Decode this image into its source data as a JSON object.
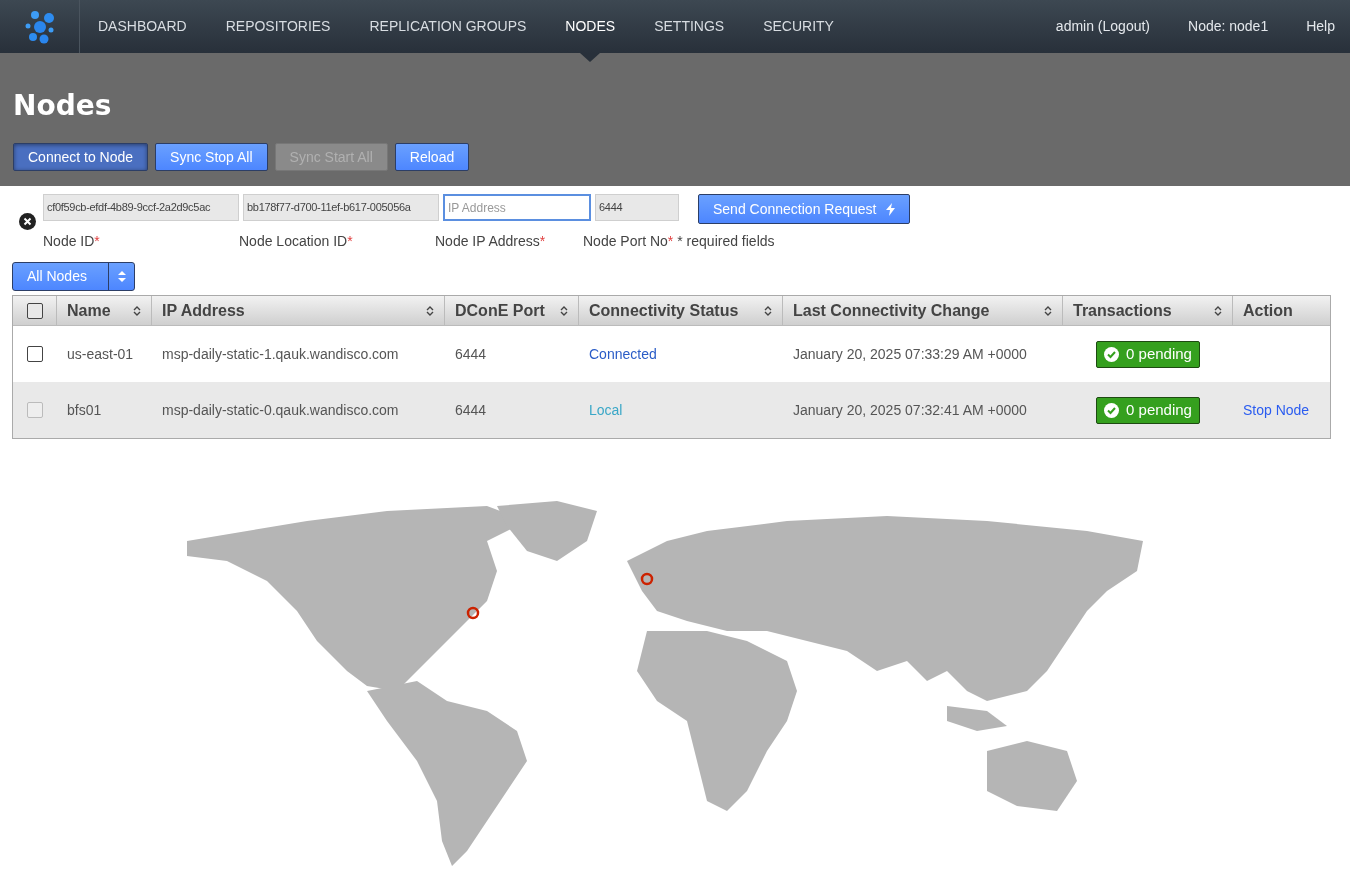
{
  "nav": {
    "items": [
      {
        "label": "DASHBOARD",
        "selected": false
      },
      {
        "label": "REPOSITORIES",
        "selected": false
      },
      {
        "label": "REPLICATION GROUPS",
        "selected": false
      },
      {
        "label": "NODES",
        "selected": true
      },
      {
        "label": "SETTINGS",
        "selected": false
      },
      {
        "label": "SECURITY",
        "selected": false
      }
    ],
    "right_links": [
      "admin (Logout)",
      "Node: node1",
      "Help"
    ]
  },
  "page_title": "Nodes",
  "toolbar": [
    {
      "label": "Connect to Node",
      "pressed": true,
      "disabled": false
    },
    {
      "label": "Sync Stop All",
      "pressed": false,
      "disabled": false
    },
    {
      "label": "Sync Start All",
      "pressed": false,
      "disabled": true
    },
    {
      "label": "Reload",
      "pressed": false,
      "disabled": false
    }
  ],
  "connect_form": {
    "fields": [
      {
        "value": "cf0f59cb-efdf-4b89-9ccf-2a2d9c5ac",
        "label": "Node ID",
        "required_mark": "*",
        "editable": false
      },
      {
        "value": "bb178f77-d700-11ef-b617-005056a",
        "label": "Node Location ID",
        "required_mark": "*",
        "editable": false
      },
      {
        "placeholder": "IP Address",
        "label": "Node IP Address",
        "required_mark": "*",
        "editable": true
      },
      {
        "value": "6444",
        "label": "Node Port No",
        "required_mark": "*",
        "editable": false
      }
    ],
    "required_note": "* required fields",
    "send_button": "Send Connection Request"
  },
  "filter": {
    "value": "All Nodes"
  },
  "table": {
    "select_all": {
      "checked": false
    },
    "columns": [
      {
        "label": "Name",
        "sortable": true
      },
      {
        "label": "IP Address",
        "sortable": true
      },
      {
        "label": "DConE Port",
        "sortable": true
      },
      {
        "label": "Connectivity Status",
        "sortable": true
      },
      {
        "label": "Last Connectivity Change",
        "sortable": true
      },
      {
        "label": "Transactions",
        "sortable": true
      },
      {
        "label": "Action",
        "sortable": false
      }
    ],
    "rows": [
      {
        "checked": false,
        "disabled": false,
        "name": "us-east-01",
        "ip": "msp-daily-static-1.qauk.wandisco.com",
        "port": "6444",
        "status": "Connected",
        "color": "#2a5cc7",
        "last_change": "January 20, 2025 07:33:29 AM +0000",
        "transactions": "0 pending"
      },
      {
        "checked": false,
        "disabled": true,
        "name": "bfs01",
        "ip": "msp-daily-static-0.qauk.wandisco.com",
        "port": "6444",
        "status": "Local",
        "color": "#3aa7c7",
        "last_change": "January 20, 2025 07:32:41 AM +0000",
        "transactions": "0 pending",
        "action": "Stop Node"
      }
    ]
  }
}
